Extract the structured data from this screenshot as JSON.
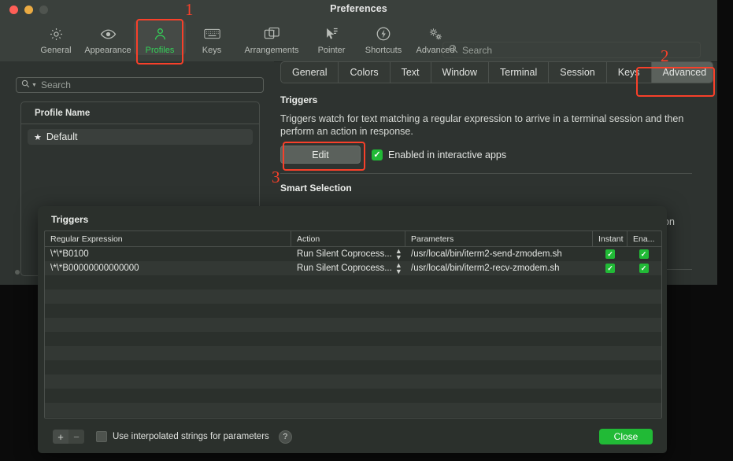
{
  "window": {
    "title": "Preferences",
    "traffic_lights": [
      "close-red",
      "minimize-yellow",
      "zoom-disabled"
    ]
  },
  "toolbar": {
    "items": [
      {
        "label": "General",
        "icon": "gear-icon",
        "selected": false
      },
      {
        "label": "Appearance",
        "icon": "eye-icon",
        "selected": false
      },
      {
        "label": "Profiles",
        "icon": "person-icon",
        "selected": true
      },
      {
        "label": "Keys",
        "icon": "keyboard-icon",
        "selected": false
      },
      {
        "label": "Arrangements",
        "icon": "windows-icon",
        "selected": false
      },
      {
        "label": "Pointer",
        "icon": "cursor-icon",
        "selected": false
      },
      {
        "label": "Shortcuts",
        "icon": "bolt-icon",
        "selected": false
      },
      {
        "label": "Advanced",
        "icon": "double-gear-icon",
        "selected": false
      }
    ],
    "search_placeholder": "Search",
    "search_label": "Search",
    "selected_color": "#34d058"
  },
  "left_pane": {
    "search_placeholder": "Search",
    "table_header": "Profile Name",
    "profiles": [
      {
        "name": "Default",
        "starred": true,
        "selected": true
      }
    ],
    "default_tag": "Default"
  },
  "right_pane": {
    "tabs": [
      {
        "label": "General",
        "active": false
      },
      {
        "label": "Colors",
        "active": false
      },
      {
        "label": "Text",
        "active": false
      },
      {
        "label": "Window",
        "active": false
      },
      {
        "label": "Terminal",
        "active": false
      },
      {
        "label": "Session",
        "active": false
      },
      {
        "label": "Keys",
        "active": false
      },
      {
        "label": "Advanced",
        "active": true
      }
    ],
    "triggers_title": "Triggers",
    "triggers_desc": "Triggers watch for text matching a regular expression to arrive in a terminal session and then perform an action in response.",
    "edit_button": "Edit",
    "enabled_checkbox_label": "Enabled in interactive apps",
    "enabled_checked": true,
    "smart_selection_title": "Smart Selection",
    "occluded_text": "on"
  },
  "dialog": {
    "title": "Triggers",
    "columns": [
      "Regular Expression",
      "Action",
      "Parameters",
      "Instant",
      "Ena..."
    ],
    "rows": [
      {
        "regex": "\\*\\*B0100",
        "action": "Run Silent Coprocess...",
        "parameters": "/usr/local/bin/iterm2-send-zmodem.sh",
        "instant": true,
        "enabled": true
      },
      {
        "regex": "\\*\\*B00000000000000",
        "action": "Run Silent Coprocess...",
        "parameters": "/usr/local/bin/iterm2-recv-zmodem.sh",
        "instant": true,
        "enabled": true
      }
    ],
    "empty_row_count": 10,
    "add_button": "+",
    "remove_button": "−",
    "interpolated_label": "Use interpolated strings for parameters",
    "interpolated_checked": false,
    "help_button": "?",
    "close_button": "Close",
    "close_color": "#21ba36"
  },
  "annotations": [
    {
      "number": "1",
      "target": "profiles-toolbar-item"
    },
    {
      "number": "2",
      "target": "advanced-tab"
    },
    {
      "number": "3",
      "target": "edit-button"
    }
  ],
  "colors": {
    "window_bg": "#2e3330",
    "chrome": "#3a403c",
    "accent_green": "#34d058",
    "annotation_red": "#f8402a",
    "checkbox_green": "#21ba36"
  }
}
